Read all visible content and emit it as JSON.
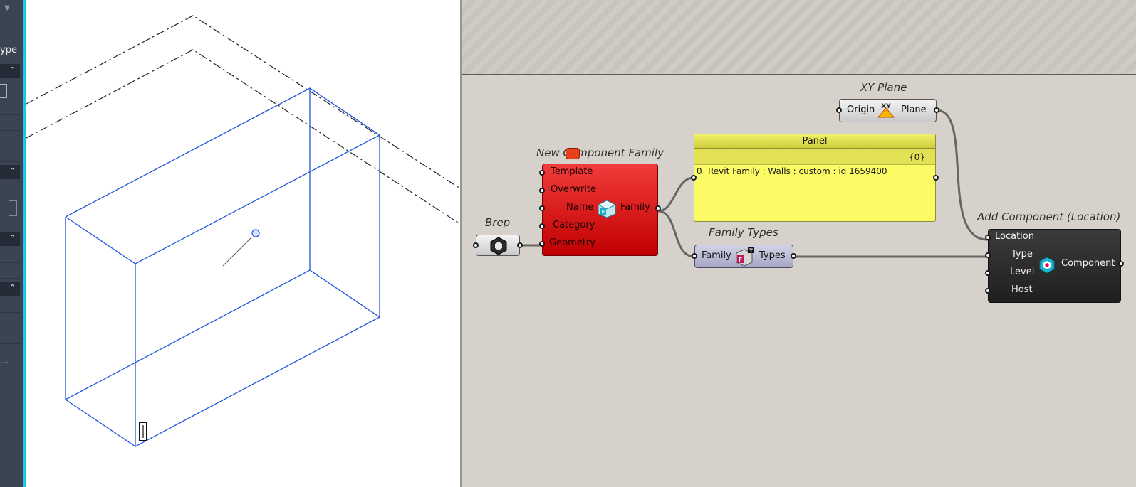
{
  "left_panel": {
    "label_fragment": "ype",
    "ellipsis": "..."
  },
  "nodes": {
    "xy_plane": {
      "title": "XY Plane",
      "inputs": [
        "Origin"
      ],
      "outputs": [
        "Plane"
      ],
      "icon": "xy-plane-icon"
    },
    "new_component_family": {
      "title": "New Component Family",
      "inputs": [
        "Template",
        "Overwrite",
        "Name",
        "Category",
        "Geometry"
      ],
      "outputs": [
        "Family"
      ],
      "state": "error",
      "icon": "family-icon"
    },
    "brep": {
      "title": "Brep",
      "icon": "brep-icon"
    },
    "panel": {
      "title": "Panel",
      "path": "{0}",
      "index": "0",
      "content": "Revit Family : Walls : custom : id 1659400"
    },
    "family_types": {
      "title": "Family Types",
      "inputs": [
        "Family"
      ],
      "outputs": [
        "Types"
      ],
      "icon": "family-types-icon"
    },
    "add_component": {
      "title": "Add Component (Location)",
      "inputs": [
        "Location",
        "Type",
        "Level",
        "Host"
      ],
      "outputs": [
        "Component"
      ],
      "icon": "component-icon"
    }
  },
  "colors": {
    "error_node": "#d10f0f",
    "panel": "#fbfb66",
    "wire": "#666666",
    "model_line": "#2255dd",
    "revit_accent": "#19c7e6"
  }
}
